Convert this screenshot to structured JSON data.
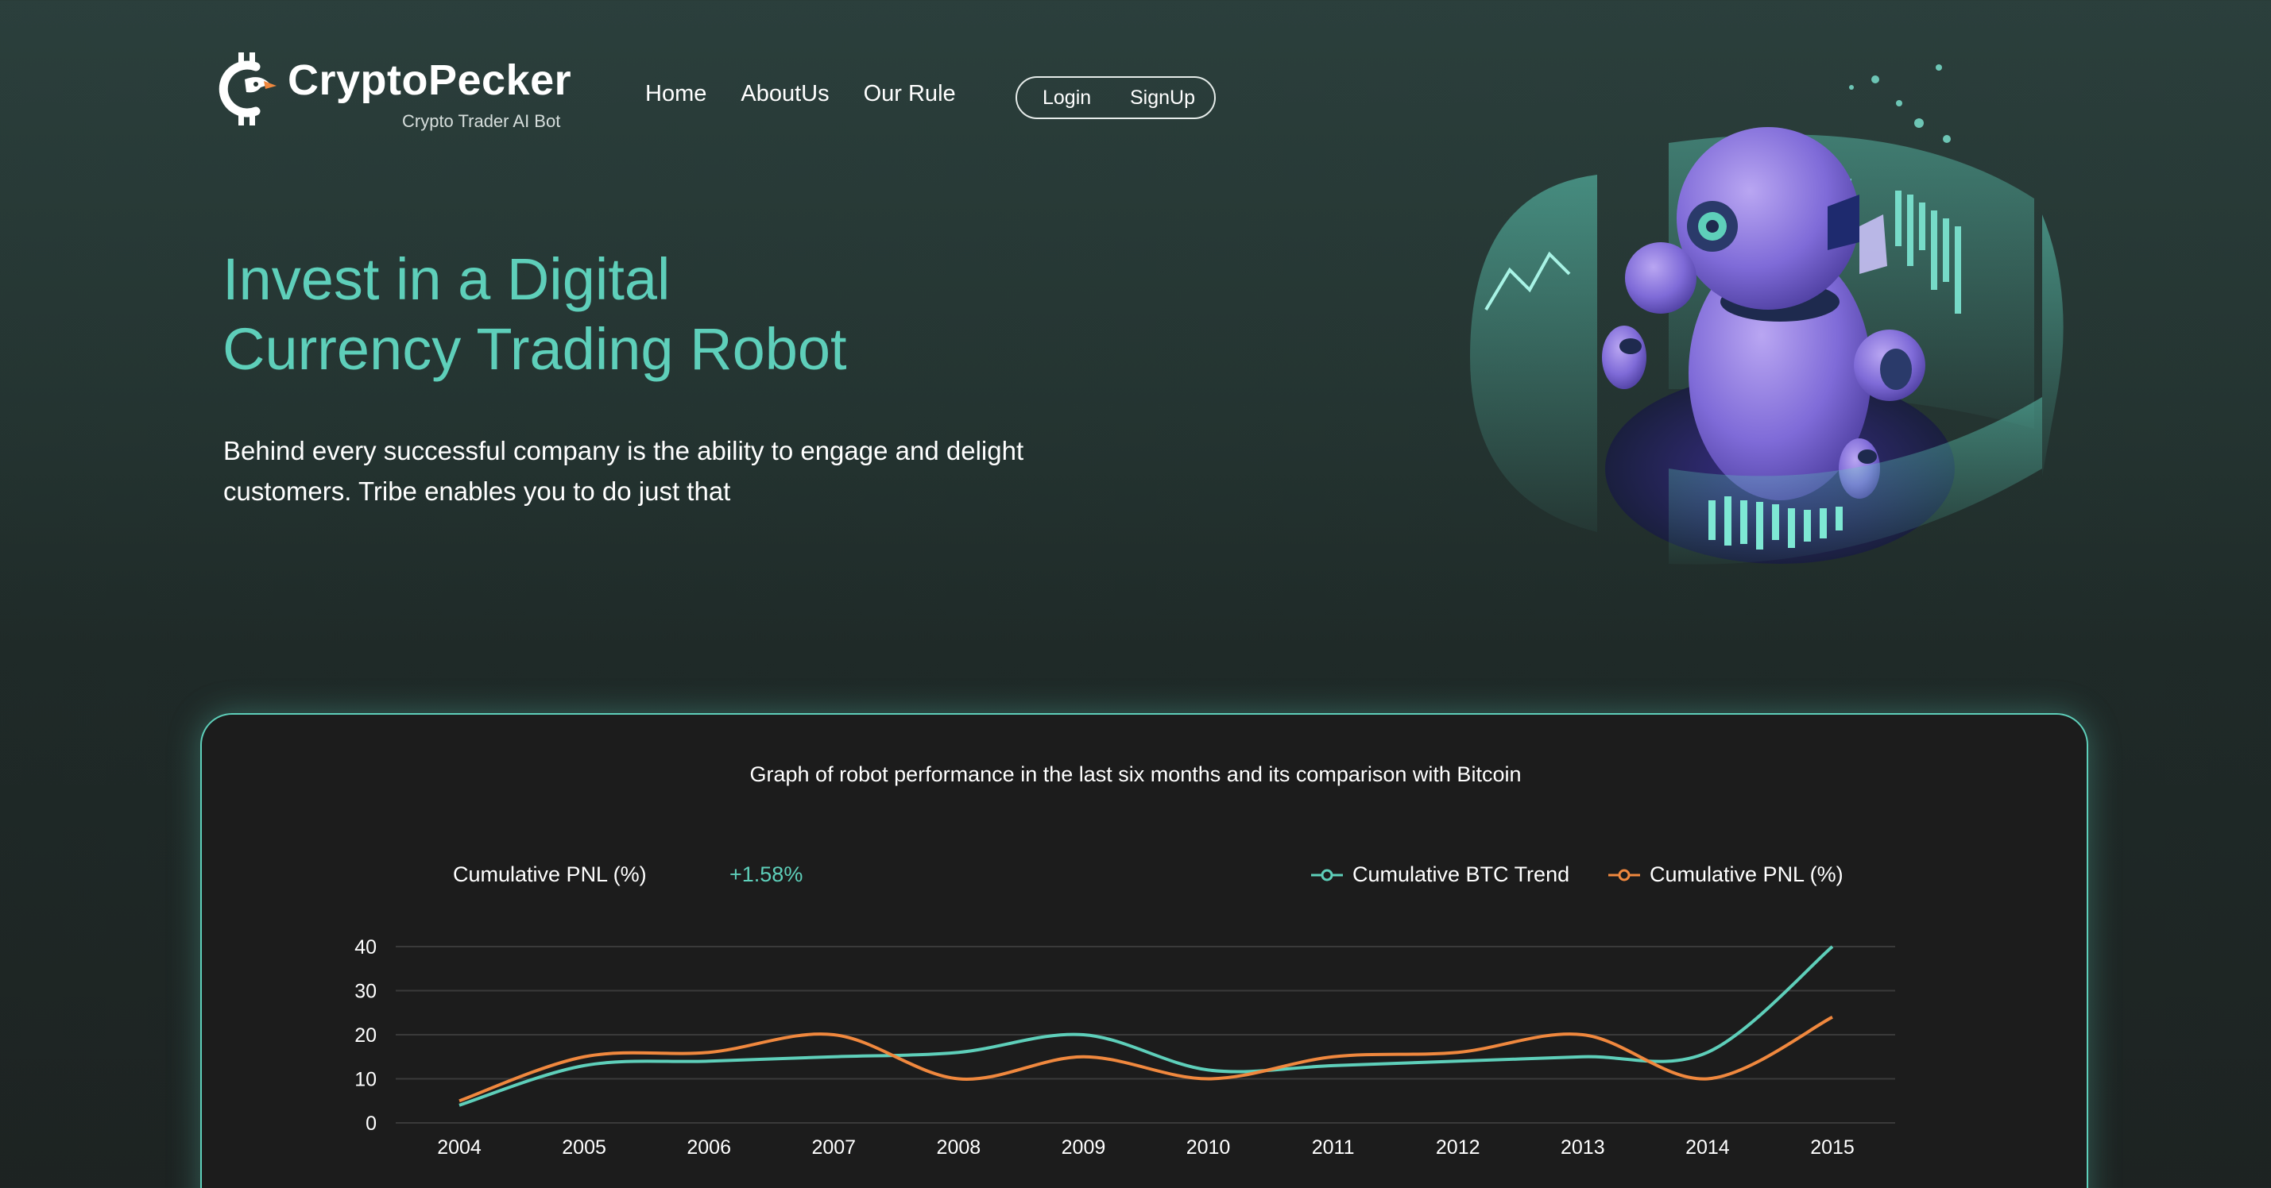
{
  "brand": {
    "name_part1": "Crypto",
    "name_part2": "Pecker",
    "tagline": "Crypto Trader AI Bot",
    "logo_icon": "crypto-c-bird-logo"
  },
  "nav": {
    "items": [
      {
        "label": "Home"
      },
      {
        "label": "AboutUs"
      },
      {
        "label": "Our Rule"
      }
    ],
    "login_label": "Login",
    "signup_label": "SignUp"
  },
  "hero": {
    "title_line1": "Invest in a Digital",
    "title_line2": "Currency Trading Robot",
    "text_line1": "Behind every successful company is the ability to engage and delight",
    "text_line2": "customers. Tribe enables you to do just that",
    "illustration": "ai-robot-hologram-illustration"
  },
  "performance": {
    "title": "Graph of robot performance in the last six months and its comparison with Bitcoin",
    "pnl_label": "Cumulative PNL (%)",
    "pnl_value": "+1.58%"
  },
  "colors": {
    "accent": "#5ecfba",
    "btc_line": "#5ecfba",
    "pnl_line": "#f0883e",
    "card_bg": "#1c1c1c"
  },
  "chart_data": {
    "type": "line",
    "x": [
      "2004",
      "2005",
      "2006",
      "2007",
      "2008",
      "2009",
      "2010",
      "2011",
      "2012",
      "2013",
      "2014",
      "2015"
    ],
    "ylim": [
      0,
      40
    ],
    "yticks": [
      0,
      10,
      20,
      30,
      40
    ],
    "grid": true,
    "legend_position": "top-right",
    "series": [
      {
        "name": "Cumulative BTC Trend",
        "color": "#5ecfba",
        "values": [
          4,
          13,
          14,
          15,
          16,
          20,
          12,
          13,
          14,
          15,
          16,
          40
        ]
      },
      {
        "name": "Cumulative PNL (%)",
        "color": "#f0883e",
        "values": [
          5,
          15,
          16,
          20,
          10,
          15,
          10,
          15,
          16,
          20,
          10,
          24
        ]
      }
    ]
  }
}
